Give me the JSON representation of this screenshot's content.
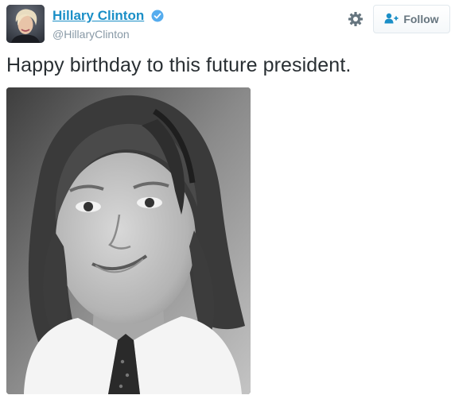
{
  "tweet": {
    "author_name": "Hillary Clinton",
    "handle": "@HillaryClinton",
    "text": "Happy birthday to this future president.",
    "follow_label": "Follow"
  },
  "icons": {
    "verified": "verified-badge-icon",
    "settings": "gear-icon",
    "follow": "add-user-icon"
  },
  "colors": {
    "link": "#1b8fc7",
    "verified": "#55acee",
    "handle": "#8899a6",
    "text": "#292f33",
    "button_text": "#66757f"
  }
}
